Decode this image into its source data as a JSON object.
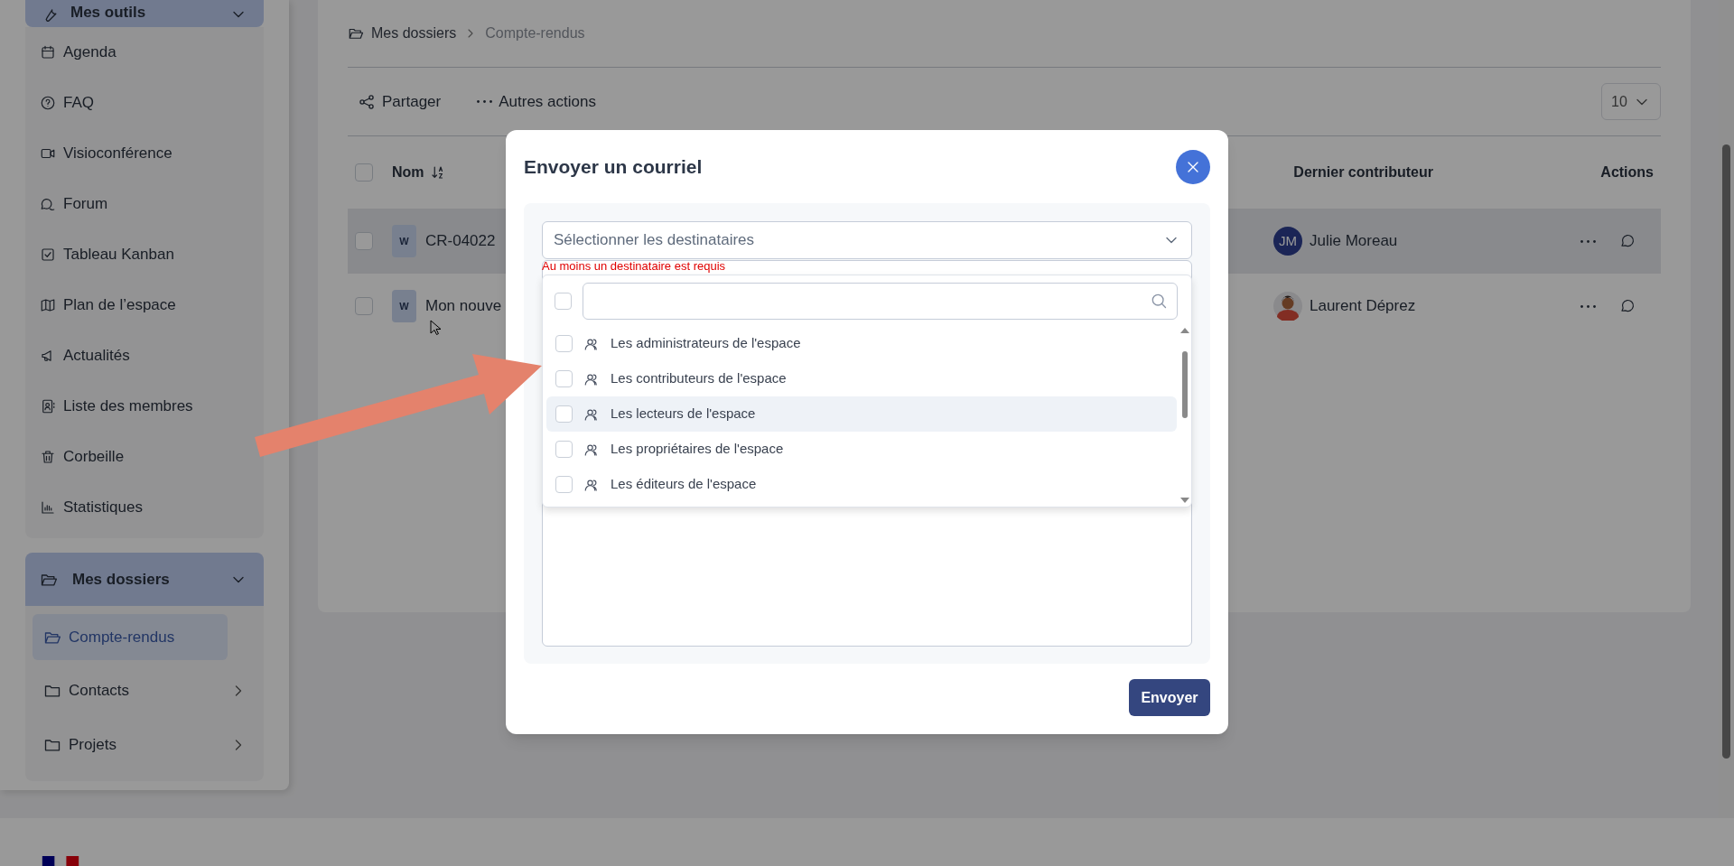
{
  "sidebar": {
    "tools_group": {
      "title": "Mes outils",
      "expanded": true,
      "items": [
        {
          "kind": "calendar",
          "label": "Agenda"
        },
        {
          "kind": "help",
          "label": "FAQ"
        },
        {
          "kind": "video",
          "label": "Visioconférence"
        },
        {
          "kind": "forum",
          "label": "Forum"
        },
        {
          "kind": "kanban",
          "label": "Tableau Kanban"
        },
        {
          "kind": "map",
          "label": "Plan de l’espace"
        },
        {
          "kind": "megaphone",
          "label": "Actualités"
        },
        {
          "kind": "members",
          "label": "Liste des membres"
        },
        {
          "kind": "trash",
          "label": "Corbeille"
        },
        {
          "kind": "stats",
          "label": "Statistiques"
        }
      ]
    },
    "folders_group": {
      "title": "Mes dossiers",
      "expanded": true,
      "items": [
        {
          "label": "Compte-rendus",
          "selected": true,
          "expandable": false
        },
        {
          "label": "Contacts",
          "selected": false,
          "expandable": true
        },
        {
          "label": "Projets",
          "selected": false,
          "expandable": true
        }
      ]
    }
  },
  "breadcrumb": [
    "Mes dossiers",
    "Compte-rendus"
  ],
  "toolbar": {
    "actions": [
      {
        "kind": "share",
        "label": "Partager"
      },
      {
        "kind": "more",
        "label": "Autres actions"
      }
    ],
    "page_size": "10"
  },
  "table": {
    "select_all_checked": false,
    "columns": [
      "Nom",
      "Dernier contributeur",
      "Actions"
    ],
    "rows": [
      {
        "checked": false,
        "highlighted": true,
        "badge": "W",
        "name": "CR-04022",
        "contributor": {
          "kind": "initials",
          "initials": "JM",
          "name": "Julie Moreau"
        }
      },
      {
        "checked": false,
        "highlighted": false,
        "badge": "W",
        "name": "Mon nouve",
        "contributor": {
          "kind": "avatar",
          "name": "Laurent Déprez"
        }
      }
    ]
  },
  "modal": {
    "title": "Envoyer un courriel",
    "recipients": {
      "placeholder": "Sélectionner les destinataires",
      "error": "Au moins un destinataire est requis"
    },
    "dropdown": {
      "select_all_checked": false,
      "options": [
        {
          "label": "Les administrateurs de l'espace",
          "checked": false,
          "highlighted": false
        },
        {
          "label": "Les contributeurs de l'espace",
          "checked": false,
          "highlighted": false
        },
        {
          "label": "Les lecteurs de l'espace",
          "checked": false,
          "highlighted": true
        },
        {
          "label": "Les propriétaires de l'espace",
          "checked": false,
          "highlighted": false
        },
        {
          "label": "Les éditeurs de l'espace",
          "checked": false,
          "highlighted": false
        }
      ]
    },
    "send_button": "Envoyer"
  }
}
